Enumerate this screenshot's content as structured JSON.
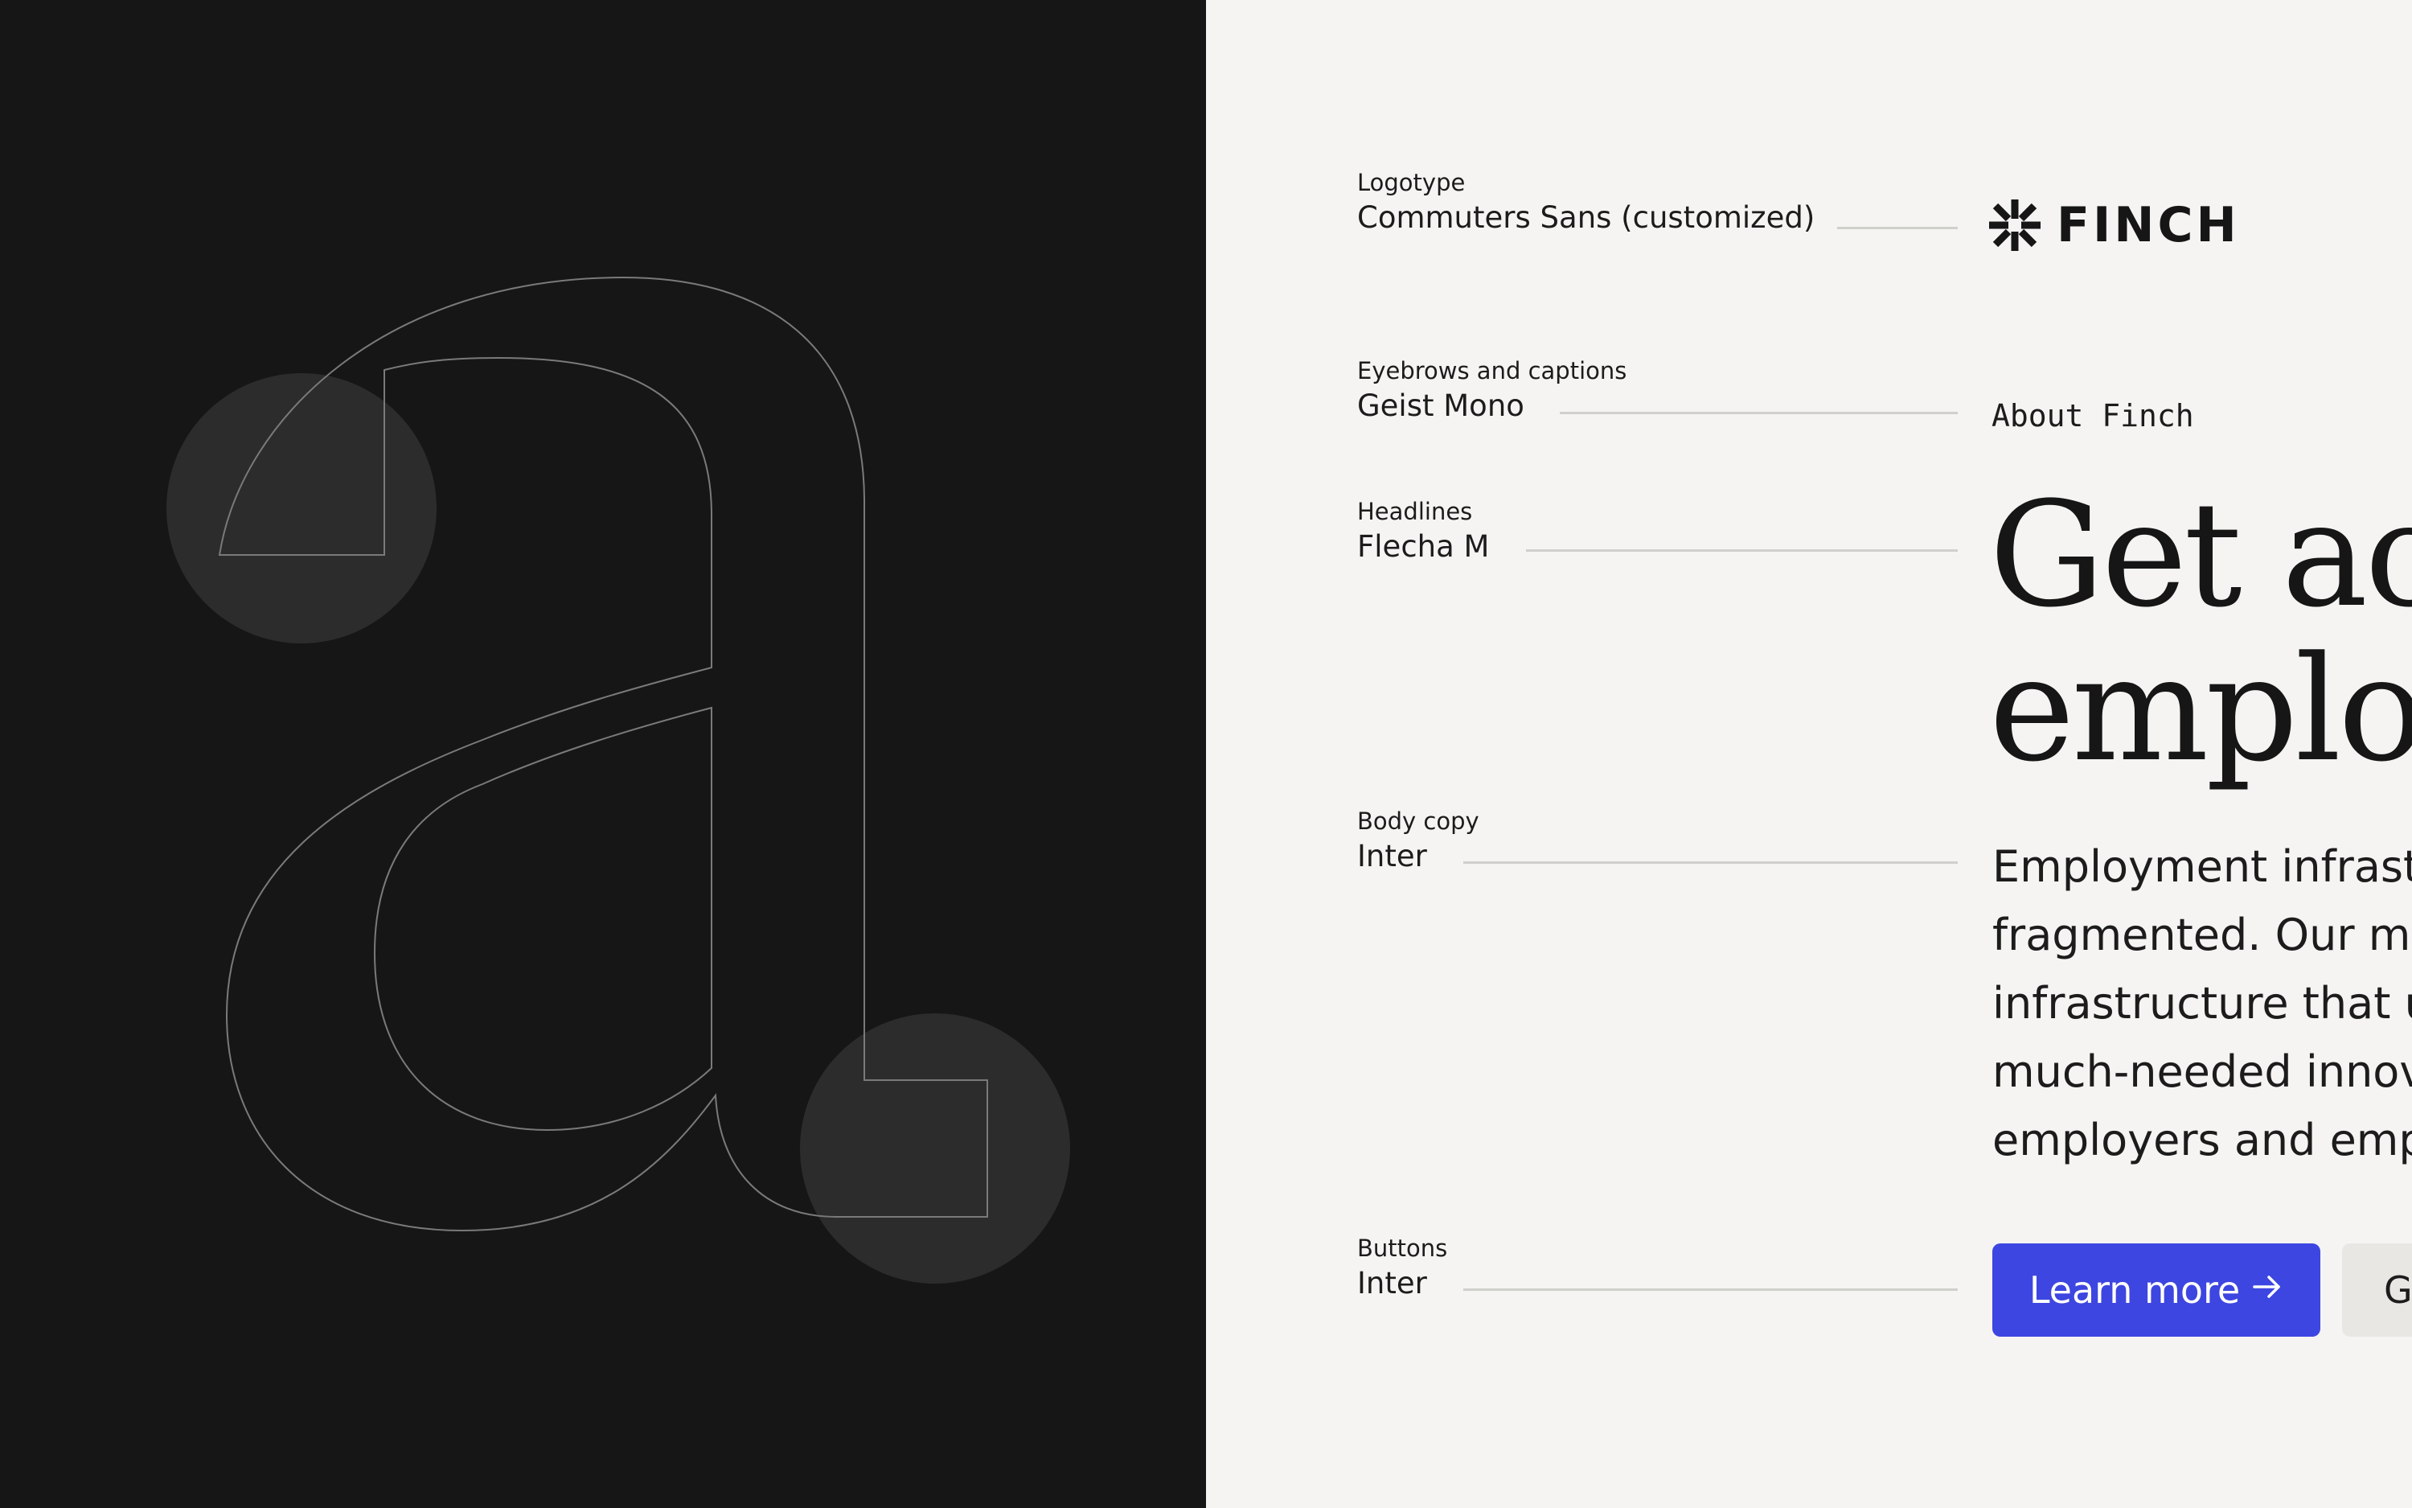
{
  "specs": [
    {
      "label": "Logotype",
      "font": "Commuters Sans (customized)"
    },
    {
      "label": "Eyebrows and captions",
      "font": "Geist Mono"
    },
    {
      "label": "Headlines",
      "font": "Flecha M"
    },
    {
      "label": "Body copy",
      "font": "Inter"
    },
    {
      "label": "Buttons",
      "font": "Inter"
    }
  ],
  "samples": {
    "logo_word": "FINCH",
    "eyebrow": "About Finch",
    "headline": [
      "Get acc",
      "employ"
    ],
    "body": [
      "Employment infrastr",
      "fragmented. Our mis",
      "infrastructure that u",
      "much-needed innov",
      "employers and emp"
    ],
    "primary_button": "Learn more",
    "primary_button_icon": "arrow-right-icon",
    "secondary_button": "G"
  },
  "colors": {
    "dark_panel": "#161616",
    "light_panel": "#f5f4f2",
    "accent": "#3d46e0",
    "secondary_button": "#e8e7e4",
    "glyph_stroke": "#7a7a7a",
    "highlight_circle": "#2c2c2c"
  }
}
